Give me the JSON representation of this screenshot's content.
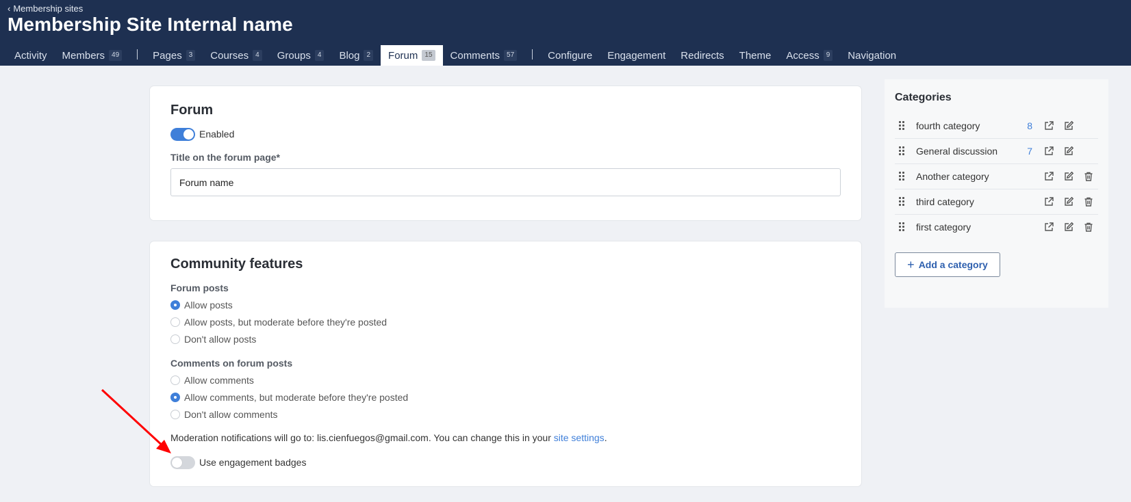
{
  "header": {
    "breadcrumb": "Membership sites",
    "title": "Membership Site Internal name",
    "tabs": [
      {
        "label": "Activity",
        "count": ""
      },
      {
        "label": "Members",
        "count": "49"
      },
      {
        "label": "Pages",
        "count": "3"
      },
      {
        "label": "Courses",
        "count": "4"
      },
      {
        "label": "Groups",
        "count": "4"
      },
      {
        "label": "Blog",
        "count": "2"
      },
      {
        "label": "Forum",
        "count": "15"
      },
      {
        "label": "Comments",
        "count": "57"
      },
      {
        "label": "Configure",
        "count": ""
      },
      {
        "label": "Engagement",
        "count": ""
      },
      {
        "label": "Redirects",
        "count": ""
      },
      {
        "label": "Theme",
        "count": ""
      },
      {
        "label": "Access",
        "count": "9"
      },
      {
        "label": "Navigation",
        "count": ""
      }
    ],
    "active_tab": "Forum"
  },
  "forum_card": {
    "heading": "Forum",
    "toggle_label": "Enabled",
    "toggle_on": true,
    "title_label": "Title on the forum page*",
    "title_value": "Forum name"
  },
  "community_card": {
    "heading": "Community features",
    "posts_label": "Forum posts",
    "posts_options": [
      "Allow posts",
      "Allow posts, but moderate before they're posted",
      "Don't allow posts"
    ],
    "posts_selected": "Allow posts",
    "comments_label": "Comments on forum posts",
    "comments_options": [
      "Allow comments",
      "Allow comments, but moderate before they're posted",
      "Don't allow comments"
    ],
    "comments_selected": "Allow comments, but moderate before they're posted",
    "note_text": "Moderation notifications will go to: lis.cienfuegos@gmail.com. You can change this in your ",
    "note_link": "site settings",
    "note_end": ".",
    "badges_label": "Use engagement badges",
    "badges_on": false
  },
  "sidebar": {
    "title": "Categories",
    "categories": [
      {
        "name": "fourth category",
        "count": "8",
        "deletable": false
      },
      {
        "name": "General discussion",
        "count": "7",
        "deletable": false
      },
      {
        "name": "Another category",
        "count": "",
        "deletable": true
      },
      {
        "name": "third category",
        "count": "",
        "deletable": true
      },
      {
        "name": "first category",
        "count": "",
        "deletable": true
      }
    ],
    "add_label": "Add a category"
  },
  "colors": {
    "header_bg": "#1e3051",
    "accent": "#3f7fd9",
    "annotation_arrow": "#ff0000"
  }
}
